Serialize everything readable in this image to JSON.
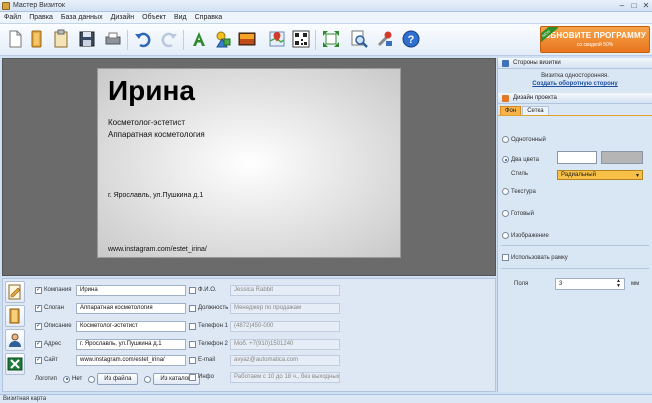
{
  "window": {
    "title": "Мастер Визиток"
  },
  "menu": [
    "Файл",
    "Правка",
    "База данных",
    "Дизайн",
    "Объект",
    "Вид",
    "Справка"
  ],
  "promo": {
    "line1": "ОБНОВИТЕ ПРОГРАММУ",
    "line2": "со скидкой 50%",
    "ribbon": "NEW"
  },
  "card": {
    "name": "Ирина",
    "slogan": "Косметолог-эстетист",
    "description": "Аппаратная косметология",
    "address": "г. Ярославль, ул.Пушкина д.1",
    "site": "www.instagram.com/estet_irina/"
  },
  "fields": {
    "left": [
      {
        "label": "Компания",
        "value": "Ирина",
        "checked": true
      },
      {
        "label": "Слоган",
        "value": "Аппаратная косметология",
        "checked": true
      },
      {
        "label": "Описание",
        "value": "Косметолог-эстетист",
        "checked": true
      },
      {
        "label": "Адрес",
        "value": "г. Ярославль, ул.Пушкина д.1",
        "checked": true
      },
      {
        "label": "Сайт",
        "value": "www.instagram.com/estet_irina/",
        "checked": true
      }
    ],
    "right": [
      {
        "label": "Ф.И.О.",
        "value": "Jessica Rabbit",
        "checked": false
      },
      {
        "label": "Должность",
        "value": "Менеджер по продажам",
        "checked": false
      },
      {
        "label": "Телефон 1",
        "value": "(4872)450-000",
        "checked": false
      },
      {
        "label": "Телефон 2",
        "value": "Моб. +7(910)1501240",
        "checked": false
      },
      {
        "label": "E-mail",
        "value": "avyaz@automatica.com",
        "checked": false
      },
      {
        "label": "Инфо",
        "value": "Работаем с 10 до 18 ч., без выходных",
        "checked": false
      }
    ],
    "logo": {
      "label": "Логотип",
      "none": "Нет",
      "from_file": "Из файла",
      "from_catalog": "Из каталога"
    }
  },
  "panel": {
    "sides_title": "Стороны визитки",
    "sides_info": "Визитка односторонняя.",
    "sides_link": "Создать оборотную сторону",
    "design_title": "Дизайн проекта",
    "tabs": [
      "Фон",
      "Сетка"
    ],
    "options": {
      "solid": "Однотонный",
      "two_colors": "Два цвета",
      "style_label": "Стиль",
      "style_value": "Радиальный",
      "texture": "Текстура",
      "ready": "Готовый",
      "image": "Изображение",
      "use_frame": "Использовать рамку",
      "margins_label": "Поля",
      "margins_value": "3",
      "margins_unit": "мм"
    },
    "colors": {
      "color1": "#ffffff",
      "color2": "#b5b5b5"
    }
  },
  "status": "Визитная карта"
}
